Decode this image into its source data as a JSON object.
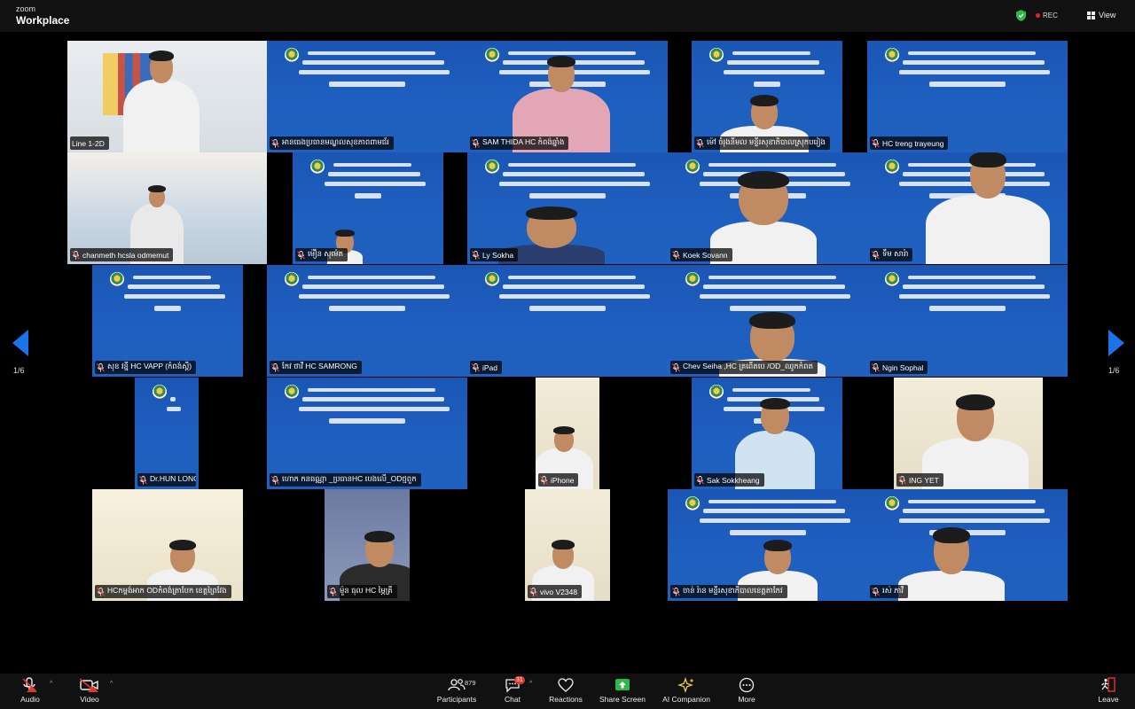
{
  "app": {
    "brand_top": "zoom",
    "brand_bottom": "Workplace"
  },
  "topbar": {
    "rec_label": "REC",
    "view_label": "View"
  },
  "pagination": {
    "left": "1/6",
    "right": "1/6"
  },
  "participants": [
    {
      "name": "Line 1-2D",
      "muted": false
    },
    {
      "name": "អានធេងប្រធានមណ្ឌលសុខភាពពាមជ័រ",
      "muted": true
    },
    {
      "name": "SAM THIDA HC កំពង់ឆ្នាំង",
      "muted": true
    },
    {
      "name": "ម៉ៅ ចំរុងនីមល មន្ទីរសុខាភិបាលស្រុកបរៀង",
      "muted": true
    },
    {
      "name": "HC treng trayeung",
      "muted": true
    },
    {
      "name": "chanmeth hcsla odmemut",
      "muted": true
    },
    {
      "name": "ម៉ឿន សុម៉េត",
      "muted": true
    },
    {
      "name": "Ly Sokha",
      "muted": true
    },
    {
      "name": "Koek Sovann",
      "muted": true
    },
    {
      "name": "ទឹម សារ៉ា",
      "muted": true
    },
    {
      "name": "សុខ វន្នី HC VAPP (កំពង់ស្ពឺ)",
      "muted": true
    },
    {
      "name": "កែវ ថាវី HC SAMRONG",
      "muted": true
    },
    {
      "name": "iPad",
      "muted": true
    },
    {
      "name": "Chev Seiha ,HC គ្រពើតបេ /OD_ឈូកកំពត",
      "muted": true
    },
    {
      "name": "Ngin Sophal",
      "muted": true
    },
    {
      "name": "Dr.HUN LONG (OD មុខកំពូល)",
      "muted": true
    },
    {
      "name": "ហោក កនធណ្ណា _ប្រធានHC បេងលើ_ODថ្មពួក",
      "muted": true
    },
    {
      "name": "iPhone",
      "muted": true
    },
    {
      "name": "Sak Sokkheang",
      "muted": true
    },
    {
      "name": "ING YET",
      "muted": true
    },
    {
      "name": "HCកម្ពង់អាក ODកំពង់ត្រាបែក ខេត្តព្រៃវែង",
      "muted": true
    },
    {
      "name": "ម៉ួន ធុល HC ម្ភៃគ្រី",
      "muted": true
    },
    {
      "name": "vivo V2348",
      "muted": true
    },
    {
      "name": "ចាន់ រ៉ាន មន្ទីរសុខាភិបាលខេត្តតាកែវ",
      "muted": true
    },
    {
      "name": "រស់ ភាវី",
      "muted": true
    }
  ],
  "toolbar": {
    "audio": "Audio",
    "video": "Video",
    "participants": "Participants",
    "participants_count": "879",
    "chat": "Chat",
    "chat_badge": "31",
    "reactions": "Reactions",
    "share_screen": "Share Screen",
    "ai_companion": "AI Companion",
    "more": "More",
    "leave": "Leave"
  },
  "colors": {
    "accent": "#1a73e8",
    "slide_blue": "#1e5fbf",
    "muted_red": "#e0392b",
    "share_green": "#2fb84a",
    "active_outline": "#c9e06a"
  }
}
